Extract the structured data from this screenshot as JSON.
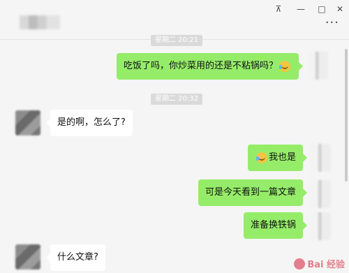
{
  "header": {
    "window_controls": {
      "pin": "⊼",
      "minimize": "—",
      "maximize": "□",
      "close": "✕"
    },
    "more": "···"
  },
  "timestamps": [
    {
      "label": "星期二 20:21"
    },
    {
      "label": "星期二 20:32"
    }
  ],
  "messages": [
    {
      "side": "right",
      "text": "吃饭了吗，你炒菜用的还是不粘锅吗？",
      "emoji": "laugh-cry-emoji"
    },
    {
      "side": "left",
      "text": "是的啊，怎么了?"
    },
    {
      "side": "right",
      "text": "我也是",
      "emoji": "laugh-cry-emoji"
    },
    {
      "side": "right",
      "text": "可是今天看到一篇文章"
    },
    {
      "side": "right",
      "text": "准备换铁锅"
    },
    {
      "side": "left",
      "text": "什么文章?"
    }
  ],
  "watermark": {
    "text": "Bai 经验"
  }
}
